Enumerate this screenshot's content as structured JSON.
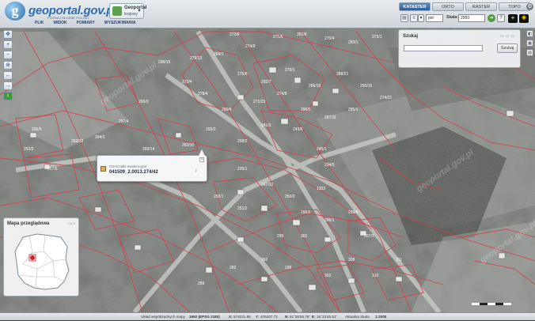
{
  "app": {
    "logo_text": "geoportal.gov.pl",
    "logo_sub": "POZNAJ SŁUŻBĘ POLSKI",
    "badge_title": "Geoportal",
    "badge_sub": "krajowy",
    "menu": [
      "PLIK",
      "WIDOK",
      "POMIARY",
      "WYSZUKIWANIA"
    ]
  },
  "map_tabs": [
    {
      "label": "KATASTER",
      "active": true
    },
    {
      "label": "ORTO",
      "active": false
    },
    {
      "label": "RASTER",
      "active": false
    },
    {
      "label": "TOPO",
      "active": false
    }
  ],
  "toolbar": {
    "unit_select": "pol",
    "scale_label": "Skala:",
    "scale_value": "2000"
  },
  "search_panel": {
    "title": "Szukaj",
    "input_value": "",
    "button_label": "Szukaj"
  },
  "popup": {
    "label": "GD-Działki ewidencyjne",
    "value": "041509_2.0013.274/42"
  },
  "overview": {
    "title": "Mapa przeglądowa"
  },
  "parcel_labels": [
    "272/8",
    "274/9",
    "271/6",
    "281/6",
    "270/4",
    "283/1",
    "273/1",
    "284/1",
    "275/8",
    "282/7",
    "279/1",
    "286/19",
    "288/21",
    "290/15",
    "274/21",
    "278/4",
    "266/4",
    "271/23",
    "274/8",
    "290/5",
    "287/11",
    "285/1",
    "273/4",
    "298/10",
    "279/13",
    "265/3",
    "297/4",
    "264/3",
    "256/5",
    "253/2",
    "257/6",
    "262/12",
    "259/14",
    "283/10",
    "255/3",
    "258/2",
    "241/3",
    "243/6",
    "245/1",
    "234/5",
    "239/1",
    "247/22",
    "250/2",
    "251/2",
    "292/1",
    "295/2",
    "296/1",
    "299/4",
    "301",
    "307/3",
    "1302",
    "299",
    "292",
    "298",
    "282",
    "289",
    "302",
    "308",
    "310",
    "311"
  ],
  "status": {
    "coord_system_label": "Układ współrzędnych mapy",
    "coord_system_value": "1992 (EPSG 2180)",
    "x_label": "X:",
    "x_value": "574031.85",
    "y_label": "Y:",
    "y_value": "406207.73",
    "n_label": "N:",
    "n_value": "51°55'56.76\"",
    "e_label": "E:",
    "e_value": "18°23'45.51\"",
    "scale_label": "Aktualna Skala",
    "scale_value": "1:2000"
  },
  "watermark": "geoportal.gov.pl"
}
